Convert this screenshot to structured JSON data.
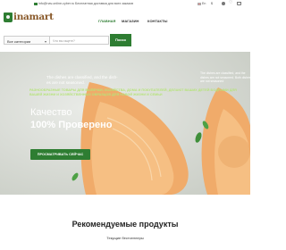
{
  "topbar": {
    "email": "info@nav-online-cyber.ru",
    "shipping": "Бесплатная доставка для всех заказов",
    "language": "En",
    "currency": "$"
  },
  "brand": {
    "logo_text": "inamart"
  },
  "nav": {
    "items": [
      "Главная",
      "Магазин",
      "Контакты"
    ]
  },
  "search": {
    "category_label": "Все категории",
    "placeholder": "Что вы ищете?",
    "button_label": "Поиск"
  },
  "hero": {
    "caption_line1": "The dishes are classified, and the dish-",
    "caption_line2": "es are not seasoned.",
    "caption_right": "The dishes are classified, and the dishes are not seasoned. Both dishes are not seasoned",
    "ribbon_text": "РАЗНООБРАЗНЫЕ ТОВАРЫ ДЛЯ ВЫПЕЧКИ, ХОЗЯЙСТВА, ДОМА И ПОКУПАТЕЛЕЙ, ДЕЛАЮТ ВАШИХ ДЕТЕЙ БОДРЫМИ ДЛЯ ВАШЕЙ ЖИЗНИ И ХОЗЯЙСТВЕННЫХ ОБРАЗЦОВ ДЛЯ НОВОЙ ЖИЗНИ И СЕМЬИ",
    "headline_line1": "Качество",
    "headline_line2": "100% Проверено",
    "cta_label": "ПРОСМАТРИВАТЬ СЕЙЧАС"
  },
  "featured": {
    "title": "Рекомендуемые продукты",
    "subtitle": "Текущие бестселлеры"
  },
  "colors": {
    "accent": "#2e7d32",
    "logo": "#8a5a2b",
    "ribbon": "#b6e37b"
  }
}
